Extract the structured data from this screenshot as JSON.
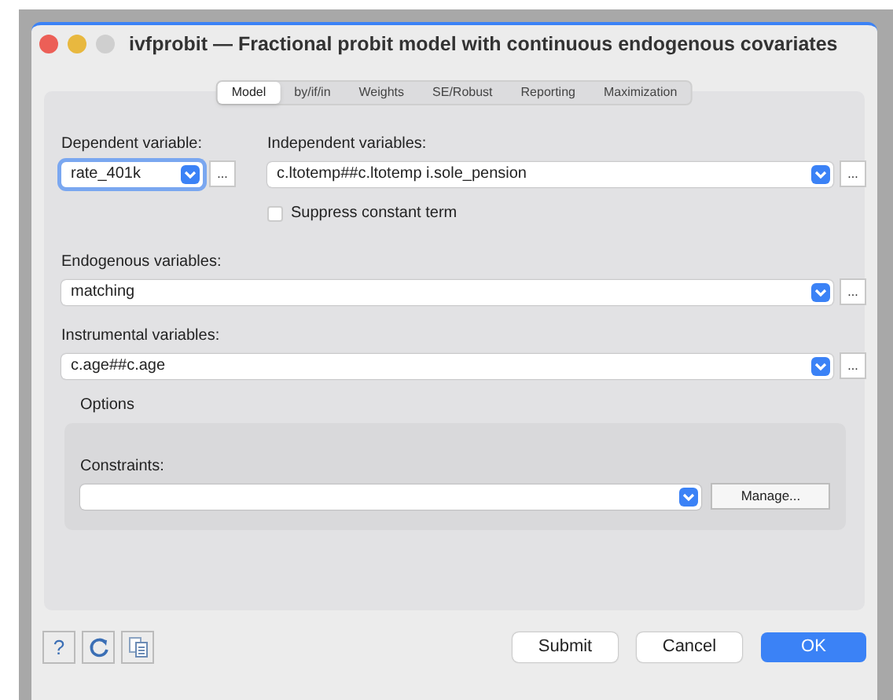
{
  "window": {
    "title": "ivfprobit — Fractional probit model with continuous endogenous covariates"
  },
  "tabs": [
    {
      "label": "Model",
      "selected": true
    },
    {
      "label": "by/if/in",
      "selected": false
    },
    {
      "label": "Weights",
      "selected": false
    },
    {
      "label": "SE/Robust",
      "selected": false
    },
    {
      "label": "Reporting",
      "selected": false
    },
    {
      "label": "Maximization",
      "selected": false
    }
  ],
  "dependent": {
    "label": "Dependent variable:",
    "value": "rate_401k",
    "focused": true,
    "browse": "..."
  },
  "independent": {
    "label": "Independent variables:",
    "value": "c.ltotemp##c.ltotemp i.sole_pension",
    "browse": "..."
  },
  "suppress_constant": {
    "label": "Suppress constant term",
    "checked": false
  },
  "endogenous": {
    "label": "Endogenous variables:",
    "value": "matching",
    "browse": "..."
  },
  "instrumental": {
    "label": "Instrumental variables:",
    "value": "c.age##c.age",
    "browse": "..."
  },
  "options": {
    "title": "Options",
    "constraints_label": "Constraints:",
    "manage_button": "Manage..."
  },
  "footer": {
    "help": "?",
    "buttons": [
      {
        "label": "Submit",
        "kind": "normal"
      },
      {
        "label": "Cancel",
        "kind": "normal"
      },
      {
        "label": "OK",
        "kind": "default"
      }
    ]
  }
}
